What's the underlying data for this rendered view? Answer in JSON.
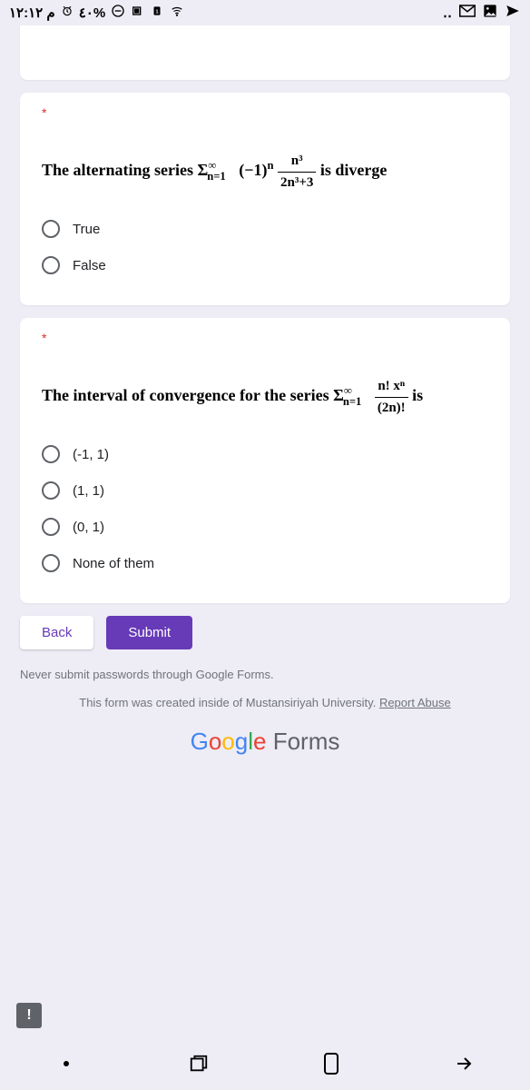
{
  "status": {
    "time": "۱۲:۱۲ م",
    "battery": "٤٠%"
  },
  "q1": {
    "required": "*",
    "prefix": "The alternating series ",
    "sum": "Σ",
    "sumSup": "∞",
    "sumSub": "n=1",
    "term1": " (−1)",
    "term1Sup": "n",
    "fracNum": "n³",
    "fracDen": "2n³+3",
    "suffix": " is diverge",
    "options": [
      "True",
      "False"
    ]
  },
  "q2": {
    "required": "*",
    "prefix": "The interval of convergence for the series ",
    "sum": "Σ",
    "sumSup": "∞",
    "sumSub": "n=1",
    "fracNum": "n! xⁿ",
    "fracDen": "(2n)!",
    "suffix": " is",
    "options": [
      "(-1, 1)",
      "(1, 1)",
      "(0, 1)",
      "None of them"
    ]
  },
  "buttons": {
    "back": "Back",
    "submit": "Submit"
  },
  "footer": {
    "warning": "Never submit passwords through Google Forms.",
    "created": "This form was created inside of Mustansiriyah University.",
    "report": "Report Abuse",
    "brand": "Forms"
  }
}
